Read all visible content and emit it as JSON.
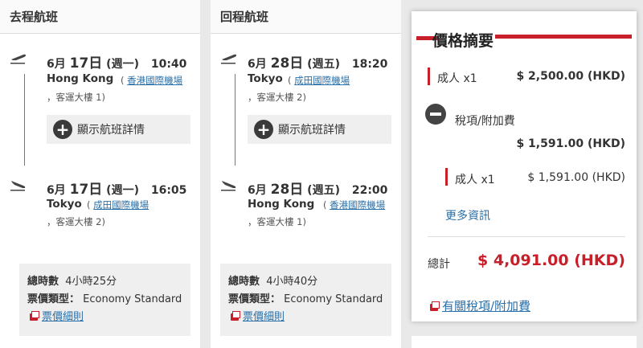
{
  "outbound": {
    "title": "去程航班",
    "depart": {
      "date_prefix": "6月",
      "day": "17日",
      "weekday": "(週一)",
      "time": "10:40",
      "city": "Hong Kong",
      "airport_link": "香港國際機場",
      "terminal": "，客運大樓 1)"
    },
    "detail_label": "顯示航班詳情",
    "arrive": {
      "date_prefix": "6月",
      "day": "17日",
      "weekday": "(週一)",
      "time": "16:05",
      "city": "Tokyo",
      "airport_link": "成田國際機場",
      "terminal": "，客運大樓 2)"
    },
    "duration_label": "總時數",
    "duration_value": "4小時25分",
    "fare_type_label": "票價類型：",
    "fare_type_value": "Economy Standard",
    "fare_rules_link": "票價細則"
  },
  "inbound": {
    "title": "回程航班",
    "depart": {
      "date_prefix": "6月",
      "day": "28日",
      "weekday": "(週五)",
      "time": "18:20",
      "city": "Tokyo",
      "airport_link": "成田國際機場",
      "terminal": "，客運大樓 2)"
    },
    "detail_label": "顯示航班詳情",
    "arrive": {
      "date_prefix": "6月",
      "day": "28日",
      "weekday": "(週五)",
      "time": "22:00",
      "city": "Hong Kong",
      "airport_link": "香港國際機場",
      "terminal": "，客運大樓 1)"
    },
    "duration_label": "總時數",
    "duration_value": "4小時40分",
    "fare_type_label": "票價類型：",
    "fare_type_value": "Economy Standard",
    "fare_rules_link": "票價細則"
  },
  "summary": {
    "title": "價格摘要",
    "adult_label": "成人 x1",
    "adult_price": "$ 2,500.00 (HKD)",
    "tax_label": "稅項/附加費",
    "tax_total": "$ 1,591.00 (HKD)",
    "tax_adult_label": "成人 x1",
    "tax_adult_price": "$ 1,591.00 (HKD)",
    "more_info": "更多資訊",
    "total_label": "總計",
    "total_value": "$ 4,091.00 (HKD)",
    "tax_link": "有關稅項/附加費"
  },
  "colors": {
    "accent": "#c8202a",
    "link": "#2a6fa8",
    "panel": "#efefef"
  }
}
